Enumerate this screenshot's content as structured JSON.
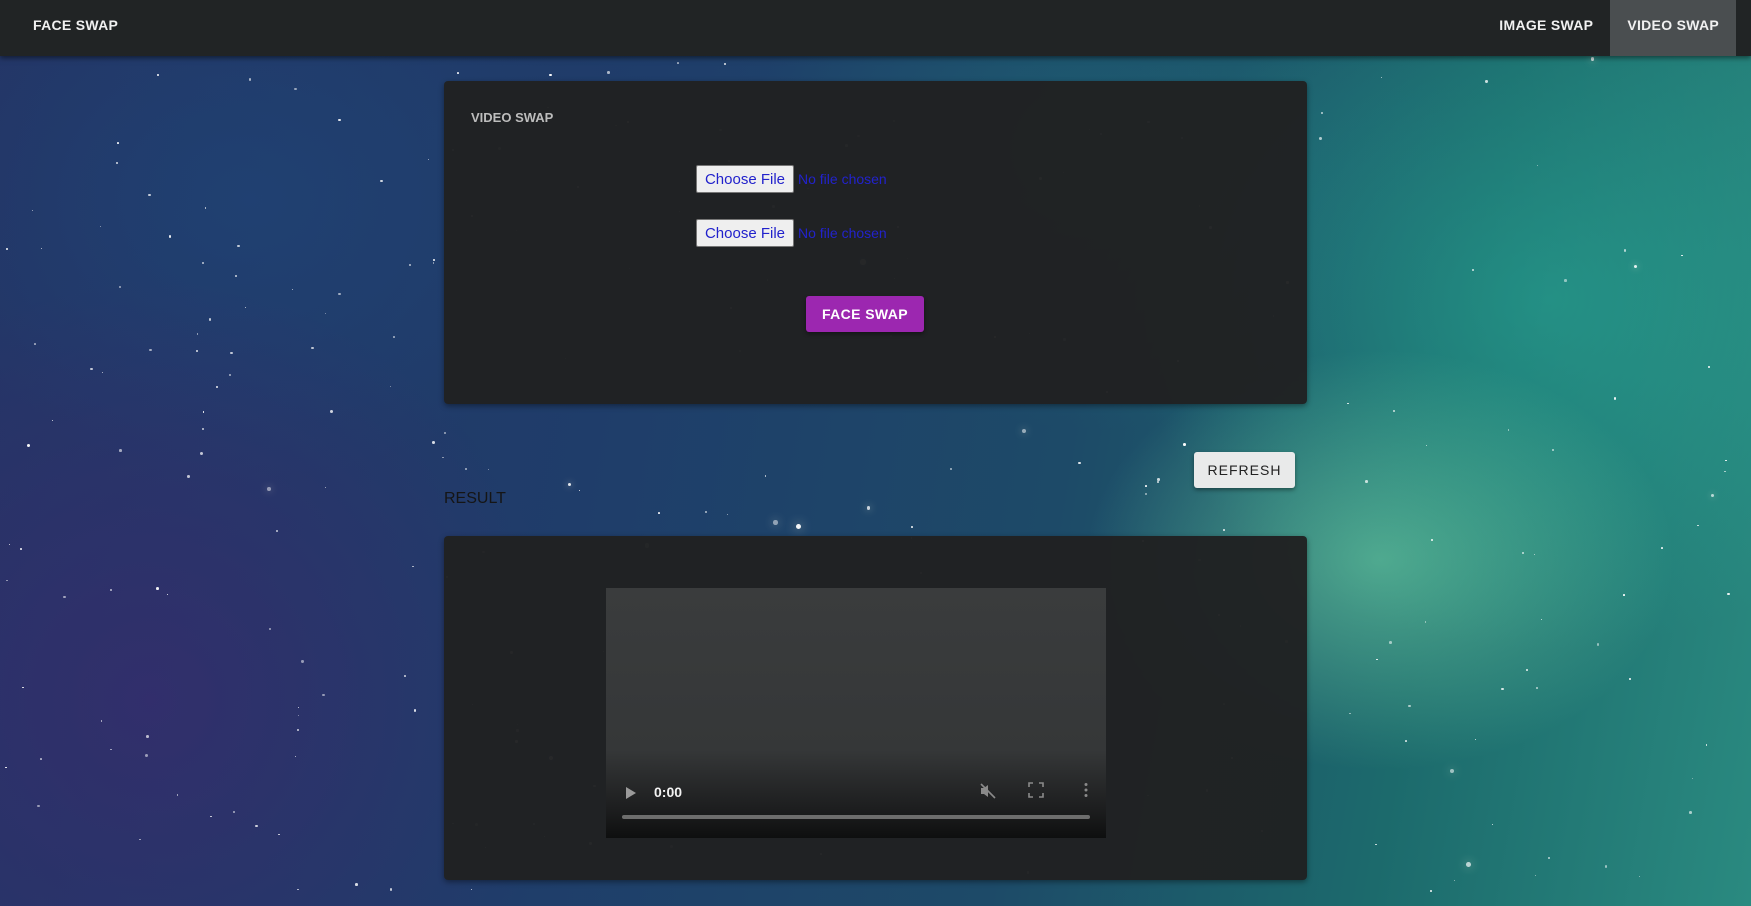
{
  "navbar": {
    "brand": "FACE SWAP",
    "links": [
      {
        "label": "IMAGE SWAP",
        "active": false
      },
      {
        "label": "VIDEO SWAP",
        "active": true
      }
    ]
  },
  "upload_card": {
    "title": "VIDEO SWAP",
    "file_inputs": [
      {
        "button_label": "Choose File",
        "status": "No file chosen"
      },
      {
        "button_label": "Choose File",
        "status": "No file chosen"
      }
    ],
    "submit_label": "FACE SWAP"
  },
  "refresh_label": "REFRESH",
  "result": {
    "label": "RESULT",
    "video": {
      "time": "0:00",
      "icons": [
        "play-icon",
        "mute-icon",
        "fullscreen-icon",
        "more-options-icon"
      ]
    }
  },
  "colors": {
    "navbar_bg": "#212425",
    "active_nav_bg": "#4a4e50",
    "primary_button": "#9c27b0",
    "card_bg": "#202122",
    "file_text": "#2222cc"
  }
}
